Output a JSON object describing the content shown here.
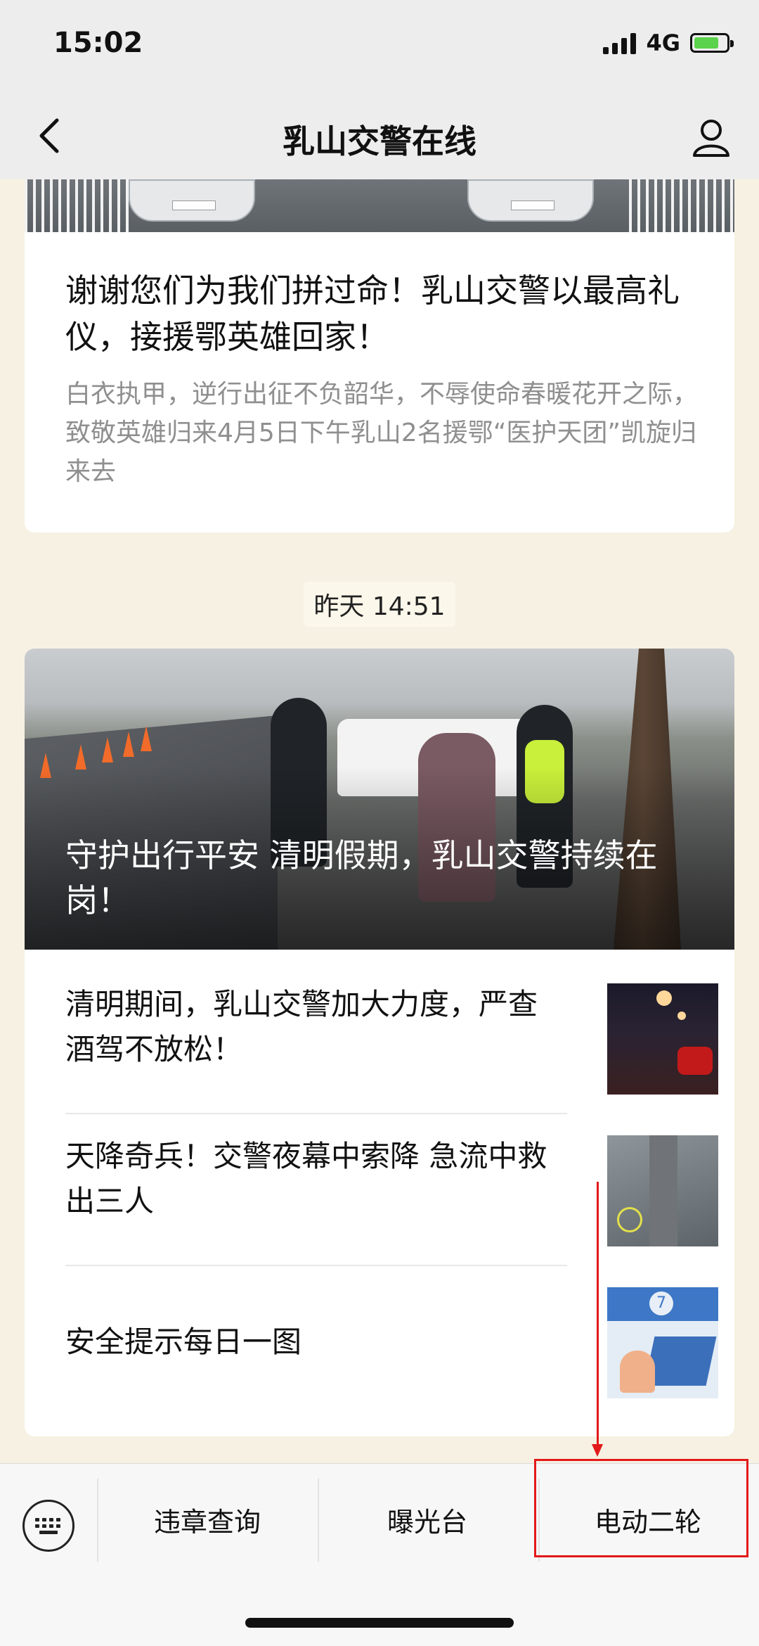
{
  "status_bar": {
    "time": "15:02",
    "network": "4G"
  },
  "nav": {
    "title": "乳山交警在线"
  },
  "article_top": {
    "title": "谢谢您们为我们拼过命！乳山交警以最高礼仪，接援鄂英雄回家！",
    "summary": "白衣执甲，逆行出征不负韶华，不辱使命春暖花开之际，致敬英雄归来4月5日下午乳山2名援鄂“医护天团”凯旋归来去"
  },
  "timestamp": "昨天 14:51",
  "group": {
    "headline": "守护出行平安  清明假期，乳山交警持续在岗！",
    "items": [
      {
        "title": "清明期间，乳山交警加大力度，严查酒驾不放松！"
      },
      {
        "title": "天降奇兵！交警夜幕中索降 急流中救出三人"
      },
      {
        "title": "安全提示每日一图"
      }
    ],
    "thumb3_badge": "7"
  },
  "bottom_menu": {
    "items": [
      "违章查询",
      "曝光台",
      "电动二轮"
    ]
  },
  "colors": {
    "annotation": "#e2191a",
    "page_bg": "#f6f1e2",
    "battery": "#5ad24b"
  },
  "icons": [
    "back-arrow-icon",
    "profile-icon",
    "keyboard-icon",
    "signal-icon",
    "battery-icon"
  ]
}
